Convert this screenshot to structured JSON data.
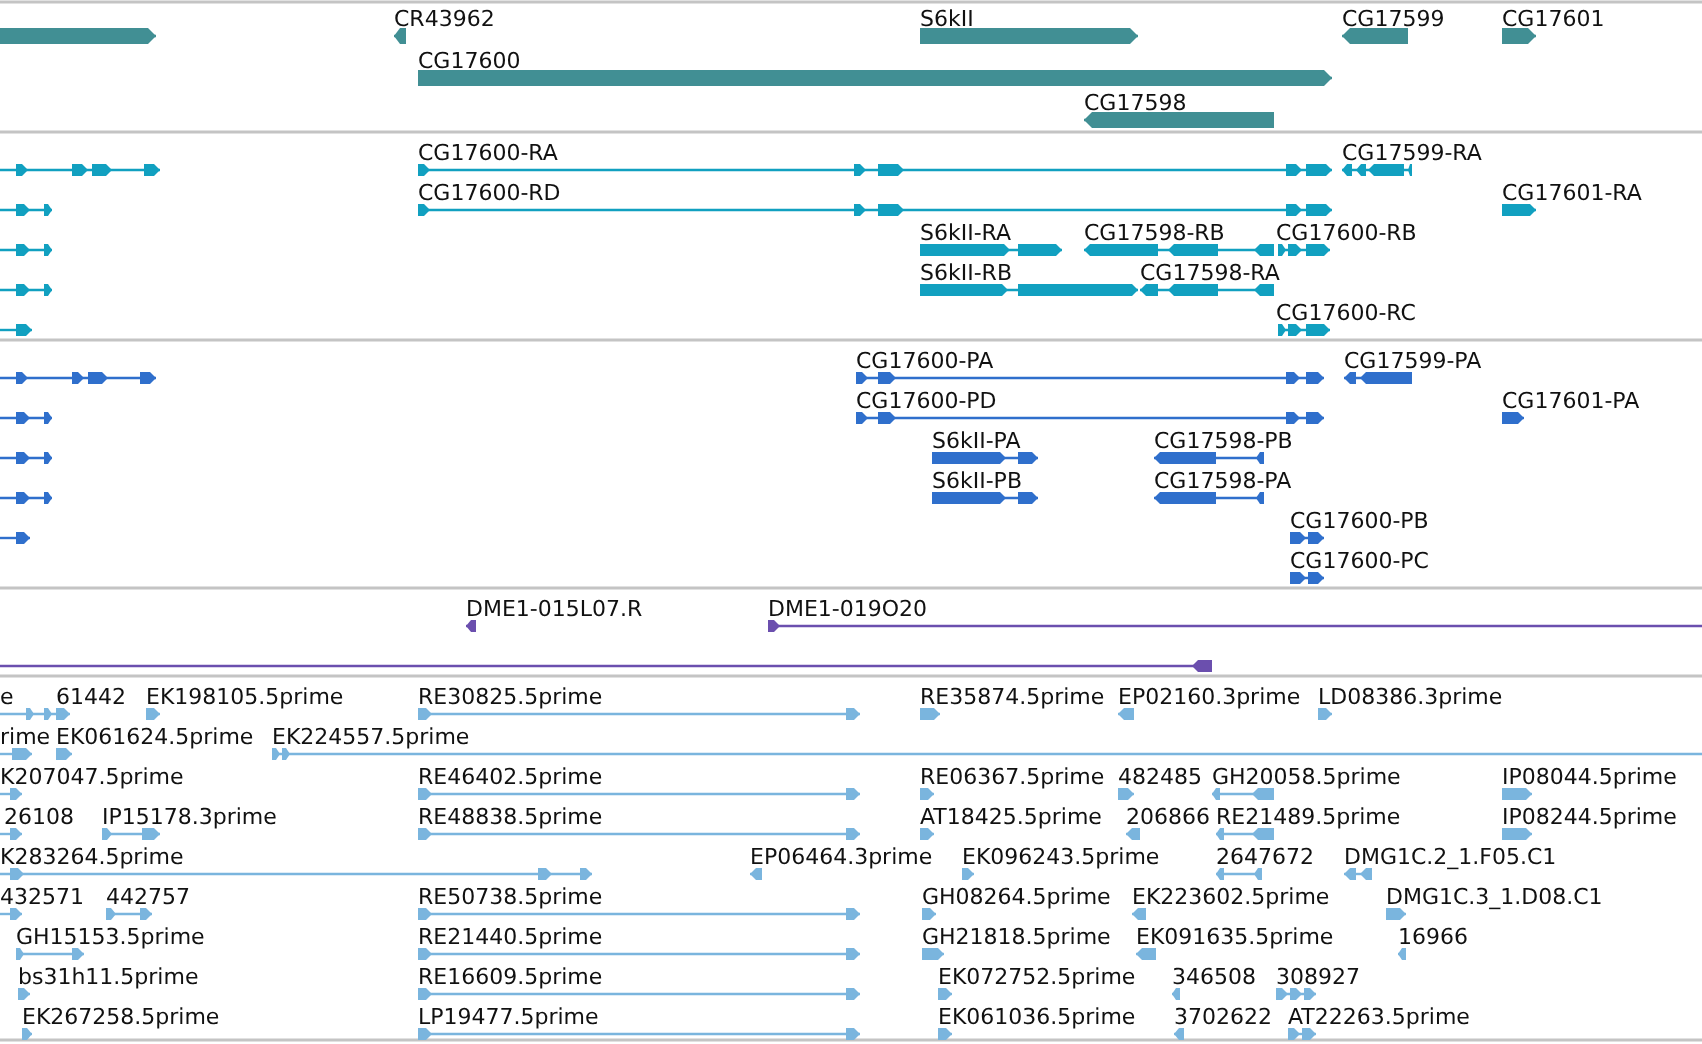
{
  "tracks": [
    {
      "kind": "gene",
      "features": [
        {
          "reverse": false
        },
        {
          "label": "CR43962",
          "reverse": true
        },
        {
          "label": "S6kII",
          "reverse": false
        },
        {
          "label": "CG17599",
          "reverse": true
        },
        {
          "label": "CG17601",
          "reverse": false
        },
        {
          "label": "CG17600",
          "reverse": false
        },
        {
          "label": "CG17598",
          "reverse": true
        }
      ]
    },
    {
      "kind": "transcript",
      "features": [
        {
          "reverse": false
        },
        {
          "reverse": false
        },
        {
          "reverse": false
        },
        {
          "reverse": false
        },
        {
          "reverse": false
        },
        {
          "label": "CG17600-RA",
          "reverse": false
        },
        {
          "label": "CG17599-RA",
          "reverse": true
        },
        {
          "label": "CG17600-RD",
          "reverse": false
        },
        {
          "label": "CG17601-RA",
          "reverse": false
        },
        {
          "label": "S6kII-RA",
          "reverse": false
        },
        {
          "label": "CG17598-RB",
          "reverse": true
        },
        {
          "label": "CG17600-RB",
          "reverse": false
        },
        {
          "label": "S6kII-RB",
          "reverse": false
        },
        {
          "label": "CG17598-RA",
          "reverse": true
        },
        {
          "label": "CG17600-RC",
          "reverse": false
        }
      ]
    },
    {
      "kind": "protein",
      "features": [
        {
          "reverse": false
        },
        {
          "reverse": false
        },
        {
          "reverse": false
        },
        {
          "reverse": false
        },
        {
          "reverse": false
        },
        {
          "label": "CG17600-PA",
          "reverse": false
        },
        {
          "label": "CG17599-PA",
          "reverse": true
        },
        {
          "label": "CG17600-PD",
          "reverse": false
        },
        {
          "label": "CG17601-PA",
          "reverse": false
        },
        {
          "label": "S6kII-PA",
          "reverse": false
        },
        {
          "label": "CG17598-PB",
          "reverse": true
        },
        {
          "label": "S6kII-PB",
          "reverse": false
        },
        {
          "label": "CG17598-PA",
          "reverse": true
        },
        {
          "label": "CG17600-PB",
          "reverse": false
        },
        {
          "label": "CG17600-PC",
          "reverse": false
        }
      ]
    },
    {
      "kind": "clone",
      "features": [
        {
          "label": "DME1-015L07.R",
          "reverse": true
        },
        {
          "label": "DME1-019O20",
          "reverse": false
        },
        {
          "reverse": true
        }
      ]
    },
    {
      "kind": "est",
      "features": [
        {
          "label": "e",
          "reverse": false
        },
        {
          "label": "61442",
          "reverse": false
        },
        {
          "label": "EK198105.5prime",
          "reverse": false
        },
        {
          "label": "RE30825.5prime",
          "reverse": false
        },
        {
          "label": "RE35874.5prime",
          "reverse": false
        },
        {
          "label": "EP02160.3prime",
          "reverse": true
        },
        {
          "label": "LD08386.3prime",
          "reverse": false
        },
        {
          "label": "rime",
          "reverse": false
        },
        {
          "label": "EK061624.5prime",
          "reverse": false
        },
        {
          "label": "EK224557.5prime",
          "reverse": false
        },
        {
          "label": "K207047.5prime",
          "reverse": false
        },
        {
          "label": "RE46402.5prime",
          "reverse": false
        },
        {
          "label": "RE06367.5prime",
          "reverse": false
        },
        {
          "label": "482485",
          "reverse": false
        },
        {
          "label": "GH20058.5prime",
          "reverse": true
        },
        {
          "label": "IP08044.5prime",
          "reverse": false
        },
        {
          "label": "26108",
          "reverse": false
        },
        {
          "label": "IP15178.3prime",
          "reverse": false
        },
        {
          "label": "RE48838.5prime",
          "reverse": false
        },
        {
          "label": "AT18425.5prime",
          "reverse": false
        },
        {
          "label": "206866",
          "reverse": true
        },
        {
          "label": "RE21489.5prime",
          "reverse": true
        },
        {
          "label": "IP08244.5prime",
          "reverse": false
        },
        {
          "label": "K283264.5prime",
          "reverse": false
        },
        {
          "label": "EP06464.3prime",
          "reverse": true
        },
        {
          "label": "EK096243.5prime",
          "reverse": false
        },
        {
          "label": "2647672",
          "reverse": true
        },
        {
          "label": "DMG1C.2_1.F05.C1",
          "reverse": true
        },
        {
          "label": "432571",
          "reverse": false
        },
        {
          "label": "442757",
          "reverse": false
        },
        {
          "label": "RE50738.5prime",
          "reverse": false
        },
        {
          "label": "GH08264.5prime",
          "reverse": false
        },
        {
          "label": "EK223602.5prime",
          "reverse": true
        },
        {
          "label": "DMG1C.3_1.D08.C1",
          "reverse": false
        },
        {
          "label": "GH15153.5prime",
          "reverse": false
        },
        {
          "label": "RE21440.5prime",
          "reverse": false
        },
        {
          "label": "GH21818.5prime",
          "reverse": false
        },
        {
          "label": "EK091635.5prime",
          "reverse": true
        },
        {
          "label": "16966",
          "reverse": true
        },
        {
          "label": "bs31h11.5prime",
          "reverse": false
        },
        {
          "label": "RE16609.5prime",
          "reverse": false
        },
        {
          "label": "EK072752.5prime",
          "reverse": false
        },
        {
          "label": "346508",
          "reverse": true
        },
        {
          "label": "308927",
          "reverse": false
        },
        {
          "label": "EK267258.5prime",
          "reverse": false
        },
        {
          "label": "LP19477.5prime",
          "reverse": false
        },
        {
          "label": "EK061036.5prime",
          "reverse": false
        },
        {
          "label": "3702622",
          "reverse": true
        },
        {
          "label": "AT22263.5prime",
          "reverse": false
        }
      ]
    }
  ]
}
